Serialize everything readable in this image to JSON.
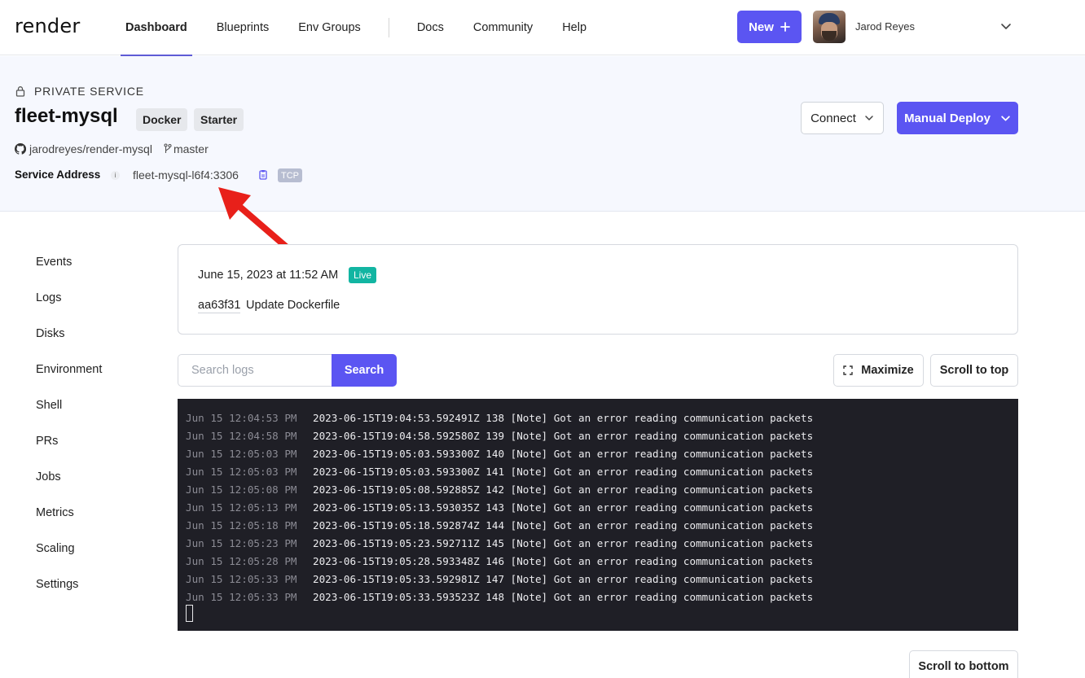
{
  "brand": {
    "logo_text": "render"
  },
  "nav": {
    "items": [
      {
        "label": "Dashboard",
        "active": true
      },
      {
        "label": "Blueprints"
      },
      {
        "label": "Env Groups"
      },
      {
        "label": "Docs"
      },
      {
        "label": "Community"
      },
      {
        "label": "Help"
      }
    ],
    "new_button_label": "New",
    "new_button_icon": "plus-icon",
    "user_name": "Jarod Reyes"
  },
  "service": {
    "type_label": "PRIVATE SERVICE",
    "name": "fleet-mysql",
    "badges": [
      "Docker",
      "Starter"
    ],
    "repo": "jarodreyes/render-mysql",
    "branch": "master",
    "address_label": "Service Address",
    "address_value": "fleet-mysql-l6f4:3306",
    "protocol_badge": "TCP"
  },
  "actions": {
    "connect_label": "Connect",
    "deploy_label": "Manual Deploy"
  },
  "sidebar": {
    "items": [
      "Events",
      "Logs",
      "Disks",
      "Environment",
      "Shell",
      "PRs",
      "Jobs",
      "Metrics",
      "Scaling",
      "Settings"
    ]
  },
  "deploy": {
    "date": "June 15, 2023 at 11:52 AM",
    "status": "Live",
    "commit_hash": "aa63f31",
    "commit_message": "Update Dockerfile"
  },
  "logs_toolbar": {
    "search_placeholder": "Search logs",
    "search_button": "Search",
    "maximize_label": "Maximize",
    "scroll_top_label": "Scroll to top",
    "scroll_bottom_label": "Scroll to bottom"
  },
  "logs": [
    {
      "time": "Jun 15 12:04:53 PM",
      "message": "2023-06-15T19:04:53.592491Z 138 [Note] Got an error reading communication packets"
    },
    {
      "time": "Jun 15 12:04:58 PM",
      "message": "2023-06-15T19:04:58.592580Z 139 [Note] Got an error reading communication packets"
    },
    {
      "time": "Jun 15 12:05:03 PM",
      "message": "2023-06-15T19:05:03.593300Z 140 [Note] Got an error reading communication packets"
    },
    {
      "time": "Jun 15 12:05:03 PM",
      "message": "2023-06-15T19:05:03.593300Z 141 [Note] Got an error reading communication packets"
    },
    {
      "time": "Jun 15 12:05:08 PM",
      "message": "2023-06-15T19:05:08.592885Z 142 [Note] Got an error reading communication packets"
    },
    {
      "time": "Jun 15 12:05:13 PM",
      "message": "2023-06-15T19:05:13.593035Z 143 [Note] Got an error reading communication packets"
    },
    {
      "time": "Jun 15 12:05:18 PM",
      "message": "2023-06-15T19:05:18.592874Z 144 [Note] Got an error reading communication packets"
    },
    {
      "time": "Jun 15 12:05:23 PM",
      "message": "2023-06-15T19:05:23.592711Z 145 [Note] Got an error reading communication packets"
    },
    {
      "time": "Jun 15 12:05:28 PM",
      "message": "2023-06-15T19:05:28.593348Z 146 [Note] Got an error reading communication packets"
    },
    {
      "time": "Jun 15 12:05:33 PM",
      "message": "2023-06-15T19:05:33.592981Z 147 [Note] Got an error reading communication packets"
    },
    {
      "time": "Jun 15 12:05:33 PM",
      "message": "2023-06-15T19:05:33.593523Z 148 [Note] Got an error reading communication packets"
    }
  ],
  "colors": {
    "accent": "#5b55f2",
    "live": "#12b5a2",
    "annotation_arrow": "#e8201a",
    "terminal_bg": "#1f1f26"
  }
}
